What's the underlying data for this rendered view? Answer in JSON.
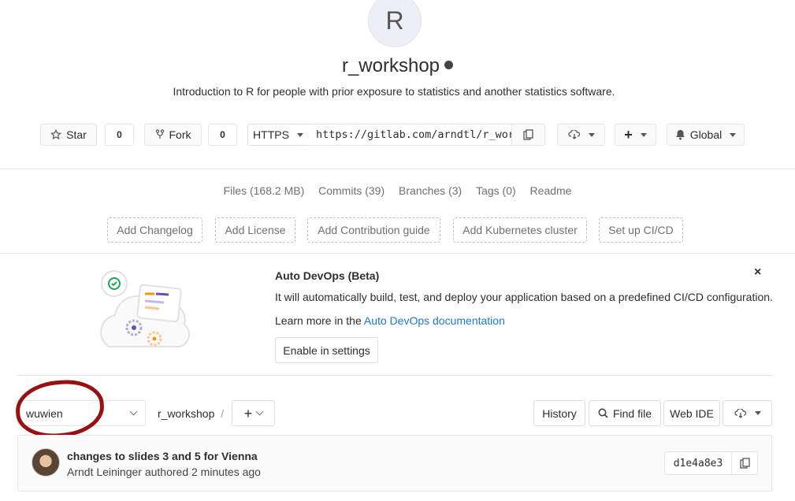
{
  "project": {
    "avatar_letter": "R",
    "name": "r_workshop",
    "description": "Introduction to R for people with prior exposure to statistics and another statistics software."
  },
  "actions": {
    "star_label": "Star",
    "star_count": "0",
    "fork_label": "Fork",
    "fork_count": "0",
    "protocol": "HTTPS",
    "clone_url": "https://gitlab.com/arndtl/r_workshop.git",
    "notification_label": "Global"
  },
  "stats": {
    "files": "Files (168.2 MB)",
    "commits": "Commits (39)",
    "branches": "Branches (3)",
    "tags": "Tags (0)",
    "readme": "Readme"
  },
  "suggestions": [
    "Add Changelog",
    "Add License",
    "Add Contribution guide",
    "Add Kubernetes cluster",
    "Set up CI/CD"
  ],
  "devops": {
    "title": "Auto DevOps (Beta)",
    "text": "It will automatically build, test, and deploy your application based on a predefined CI/CD configuration.",
    "learn_prefix": "Learn more in the ",
    "learn_link": "Auto DevOps documentation",
    "button": "Enable in settings",
    "close": "×"
  },
  "tree": {
    "branch": "wuwien",
    "path": "r_workshop",
    "separator": "/",
    "history": "History",
    "find_file": "Find file",
    "web_ide": "Web IDE"
  },
  "commit": {
    "title": "changes to slides 3 and 5 for Vienna",
    "author": "Arndt Leininger",
    "authored": "authored 2 minutes ago",
    "sha": "d1e4a8e3"
  },
  "colors": {
    "link": "#1f78d1",
    "annotation": "#9a0f0f"
  }
}
